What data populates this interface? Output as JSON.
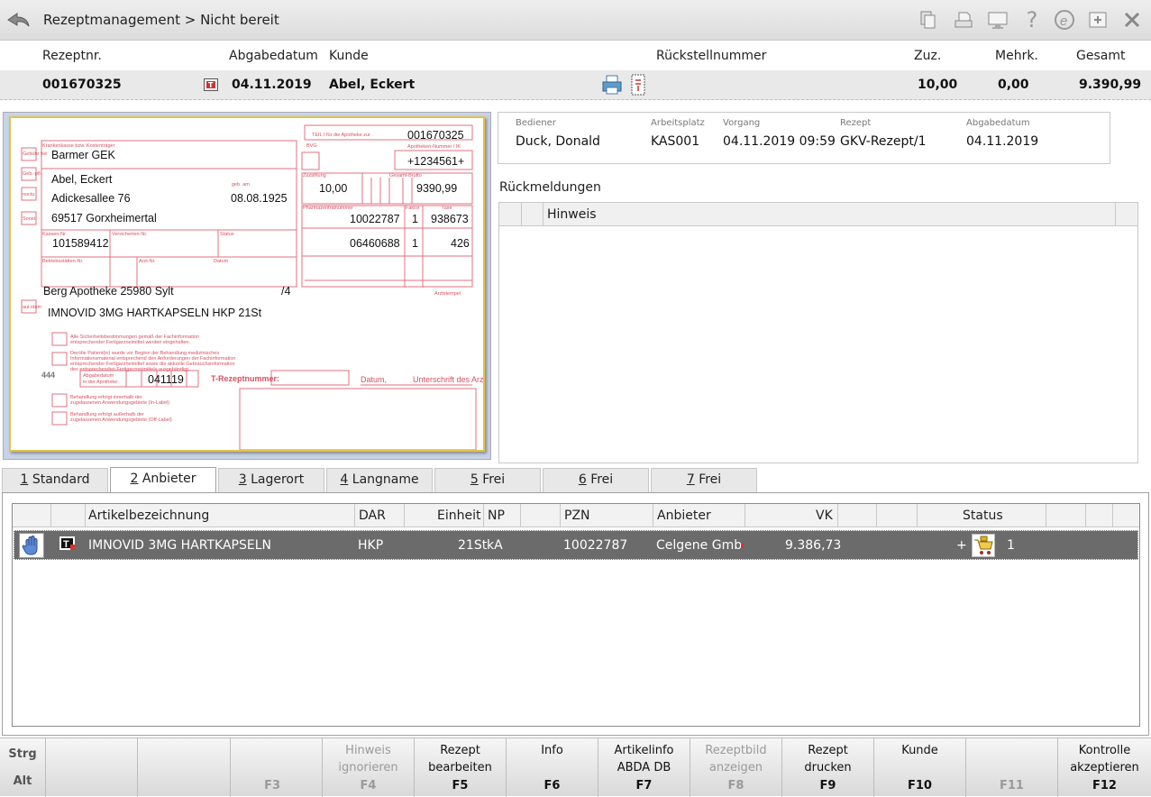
{
  "header": {
    "title": "Rezeptmanagement > Nicht bereit"
  },
  "info": {
    "labels": {
      "rezeptnr": "Rezeptnr.",
      "abgabedatum": "Abgabedatum",
      "kunde": "Kunde",
      "rueckstellnummer": "Rückstellnummer",
      "zuz": "Zuz.",
      "mehrk": "Mehrk.",
      "gesamt": "Gesamt"
    },
    "values": {
      "rezeptnr": "001670325",
      "abgabedatum": "04.11.2019",
      "kunde": "Abel, Eckert",
      "zuz": "10,00",
      "mehrk": "0,00",
      "gesamt": "9.390,99"
    }
  },
  "rx": {
    "teil": "TEIL I für die Apotheke zur",
    "rxnr": "001670325",
    "kasse_label": "Krankenkasse bzw. Kostenträger",
    "kasse": "Barmer GEK",
    "patient": "Abel, Eckert",
    "street": "Adickesallee 76",
    "dob": "08.08.1925",
    "city": "69517 Gorxheimertal",
    "kassen_nr": "101589412",
    "apo_ik_label": "Apotheken-Nummer / IK",
    "apo_ik": "+1234561+",
    "zuzahlung_label": "Zuzahlung",
    "brutto_label": "Gesamt-Brutto",
    "zuzahlung": "10,00",
    "brutto": "9390,99",
    "pzn_label": "Pharmazentralnummer",
    "faktor_label": "Faktor",
    "taxe_label": "Taxe",
    "pzn1": "10022787",
    "f1": "1",
    "t1": "938673",
    "pzn2": "06460688",
    "f2": "1",
    "t2": "426",
    "arzt": "Berg Apotheke 25980 Sylt",
    "arzt_suffix": "/4",
    "arztstempel": "Arztstempel",
    "drug": "IMNOVID 3MG HARTKAPSELN HKP 21St",
    "abgabedatum": "041119",
    "t_rezept": "T-Rezeptnummer:",
    "datum": "Datum,",
    "unterschrift": "Unterschrift des Arztes",
    "num444": "444",
    "kassen_nr_label": "Kassen-Nr.",
    "versicherten_label": "Versicherten-Nr.",
    "status_label": "Status",
    "betrieb_label": "Betriebsstätten-Nr.",
    "arzt_nr_label": "Arzt-Nr.",
    "datum_label": "Datum",
    "geb_label": "geb. am",
    "bvg": "BVG",
    "abgabe_label1": "Abgabedatum",
    "abgabe_label2": "in der Apotheke:",
    "cb1": "Alle Sicherheitsbestimmungen gemäß der Fachinformation",
    "cb1b": "entsprechender Fertigarzneimittel werden eingehalten.",
    "cb2": "Der/die Patient(in) wurde vor Beginn der Behandlung medizinisches",
    "cb2b": "Informationsmaterial entsprechend den Anforderungen der Fachinformation",
    "cb2c": "entsprechender Fertigarzneimittel sowie die aktuelle Gebrauchsinformation",
    "cb2d": "des entsprechenden Fertigarzneimittels ausgehändigt.",
    "cb3": "Behandlung erfolgt innerhalb der",
    "cb3b": "zugelassenen Anwendungsgebiete (In-Label)",
    "cb4": "Behandlung erfolgt außerhalb der",
    "cb4b": "zugelassenen Anwendungsgebiete (Off-Label)",
    "side": [
      "Gebühr frei",
      "Geb.-pfl.",
      "noctu",
      "Sonst.",
      "aut idem"
    ]
  },
  "details": {
    "labels": {
      "bediener": "Bediener",
      "arbeitsplatz": "Arbeitsplatz",
      "vorgang": "Vorgang",
      "rezept": "Rezept",
      "abgabedatum": "Abgabedatum"
    },
    "values": {
      "bediener": "Duck, Donald",
      "arbeitsplatz": "KAS001",
      "vorgang": "04.11.2019 09:59",
      "rezept": "GKV-Rezept/1",
      "abgabedatum": "04.11.2019"
    }
  },
  "rueckmeldungen": {
    "title": "Rückmeldungen",
    "col_hinweis": "Hinweis"
  },
  "tabs": [
    {
      "key": "1",
      "label": "Standard"
    },
    {
      "key": "2",
      "label": "Anbieter"
    },
    {
      "key": "3",
      "label": "Lagerort"
    },
    {
      "key": "4",
      "label": "Langname"
    },
    {
      "key": "5",
      "label": "Frei"
    },
    {
      "key": "6",
      "label": "Frei"
    },
    {
      "key": "7",
      "label": "Frei"
    }
  ],
  "articles": {
    "columns": {
      "artikel": "Artikelbezeichnung",
      "dar": "DAR",
      "einheit": "Einheit",
      "np": "NP",
      "pzn": "PZN",
      "anbieter": "Anbieter",
      "vk": "VK",
      "status": "Status"
    },
    "row": {
      "name": "IMNOVID 3MG HARTKAPSELN",
      "dar": "HKP",
      "einheit": "21St",
      "np": "kA",
      "pzn": "10022787",
      "anbieter": "Celgene Gmbl",
      "vk": "9.386,73",
      "plus": "+",
      "qty": "1"
    }
  },
  "fkeys": {
    "strg": "Strg",
    "alt": "Alt",
    "keys": [
      {
        "label1": "",
        "label2": "",
        "num": ""
      },
      {
        "label1": "",
        "label2": "",
        "num": ""
      },
      {
        "label1": "",
        "label2": "",
        "num": "F3"
      },
      {
        "label1": "Hinweis",
        "label2": "ignorieren",
        "num": "F4"
      },
      {
        "label1": "Rezept",
        "label2": "bearbeiten",
        "num": "F5"
      },
      {
        "label1": "Info",
        "label2": "",
        "num": "F6"
      },
      {
        "label1": "Artikelinfo",
        "label2": "ABDA DB",
        "num": "F7"
      },
      {
        "label1": "Rezeptbild",
        "label2": "anzeigen",
        "num": "F8"
      },
      {
        "label1": "Rezept",
        "label2": "drucken",
        "num": "F9"
      },
      {
        "label1": "Kunde",
        "label2": "",
        "num": "F10"
      },
      {
        "label1": "",
        "label2": "",
        "num": "F11"
      },
      {
        "label1": "Kontrolle",
        "label2": "akzeptieren",
        "num": "F12"
      }
    ]
  },
  "colors": {
    "accent_red": "#d8505a",
    "selected_row": "#6b6b6b"
  }
}
